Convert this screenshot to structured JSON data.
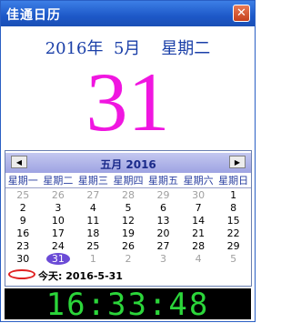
{
  "window": {
    "title": "佳通日历",
    "close_glyph": "✕"
  },
  "header": {
    "date_line": "2016年  5月    星期二",
    "big_day": "31"
  },
  "calendar": {
    "month_label": "五月  2016",
    "prev_glyph": "◀",
    "next_glyph": "▶",
    "weekdays": [
      "星期一",
      "星期二",
      "星期三",
      "星期四",
      "星期五",
      "星期六",
      "星期日"
    ],
    "weeks": [
      [
        {
          "d": "25",
          "m": true
        },
        {
          "d": "26",
          "m": true
        },
        {
          "d": "27",
          "m": true
        },
        {
          "d": "28",
          "m": true
        },
        {
          "d": "29",
          "m": true
        },
        {
          "d": "30",
          "m": true
        },
        {
          "d": "1"
        }
      ],
      [
        {
          "d": "2"
        },
        {
          "d": "3"
        },
        {
          "d": "4"
        },
        {
          "d": "5"
        },
        {
          "d": "6"
        },
        {
          "d": "7"
        },
        {
          "d": "8"
        }
      ],
      [
        {
          "d": "9"
        },
        {
          "d": "10"
        },
        {
          "d": "11"
        },
        {
          "d": "12"
        },
        {
          "d": "13"
        },
        {
          "d": "14"
        },
        {
          "d": "15"
        }
      ],
      [
        {
          "d": "16"
        },
        {
          "d": "17"
        },
        {
          "d": "18"
        },
        {
          "d": "19"
        },
        {
          "d": "20"
        },
        {
          "d": "21"
        },
        {
          "d": "22"
        }
      ],
      [
        {
          "d": "23"
        },
        {
          "d": "24"
        },
        {
          "d": "25"
        },
        {
          "d": "26"
        },
        {
          "d": "27"
        },
        {
          "d": "28"
        },
        {
          "d": "29"
        }
      ],
      [
        {
          "d": "30"
        },
        {
          "d": "31",
          "today": true
        },
        {
          "d": "1",
          "m": true
        },
        {
          "d": "2",
          "m": true
        },
        {
          "d": "3",
          "m": true
        },
        {
          "d": "4",
          "m": true
        },
        {
          "d": "5",
          "m": true
        }
      ]
    ],
    "today_text": "今天:  2016-5-31"
  },
  "clock": {
    "time": "16:33:48"
  },
  "colors": {
    "date_line": "#1a3fa8",
    "big_day": "#f016e0",
    "clock_text": "#2bd63a",
    "today_highlight": "#6b4bd6"
  }
}
